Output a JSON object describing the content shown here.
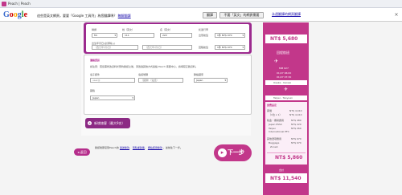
{
  "window": {
    "title": "Peach | Peach"
  },
  "google_bar": {
    "logo_letters": [
      "G",
      "o",
      "o",
      "g",
      "l",
      "e"
    ],
    "message_prefix": "這些是英文網頁，要要「Google 工具列」為您翻譯嗎？",
    "link_text": "瞭解翻譯",
    "translate_button": "翻譯",
    "never_button": "不要「英文」的網頁需要",
    "options_link": "永遠翻譯的網頁翻譯",
    "close": "×"
  },
  "form": {
    "passenger_section": {
      "title_label": "稱謂",
      "title_value": "Mr.",
      "surname_label": "姓（英文）",
      "surname_value": "111",
      "givenname_label": "名（英文）",
      "givenname_value": "222",
      "birth_label": "出生年月日(必須輸入)",
      "baggage_label": "託運行李",
      "baggage_outbound_label": "出發航班",
      "baggage_return_label": "回程航班",
      "baggage_outbound_value": "1件 NT$ 970",
      "baggage_return_value": "1件 NT$ 970",
      "dob_placeholder": "（西元年/月/日）"
    },
    "contact_section": {
      "title": "連絡資訊",
      "note": "請注意：若您需修改資料於預約確認之後，須透過其他方式連絡 Peach 客服中心，請填寫正確資料。",
      "email_label": "電子郵件",
      "phone_label": "電話號碼",
      "country_label": "聯絡國家",
      "email_placeholder": "user@",
      "phone_placeholder": "（國碼）（電話）",
      "country_value": "Japan",
      "nationality_label": "國籍",
      "nationality_value": "Japan"
    },
    "add_passenger_button": "新增旅客（最大9名）"
  },
  "footer": {
    "back_button": "返回",
    "note_prefix": "確認後即接受Peach的",
    "link1": "運送條款",
    "link2": "隱私權政策",
    "link3": "網站使用條款",
    "note_suffix": "，並前往下一步。",
    "next_button": "下一步"
  },
  "summary": {
    "outbound_price": "NT$ 5,680",
    "return_label": "回程航班",
    "flight_number": "MM 027",
    "date_depart": "01/27 06:00",
    "date_arrive": "01/27 07:30",
    "route_return": "Osaka - Kansai",
    "route_return_to": "Taipei - Taoyuan",
    "fare_type": "旅費設定",
    "fare_adult_label": "票價",
    "fare_adult_value": "NT$ 4,410",
    "fare_adult_sub": "（1位 x 1）",
    "fare_adult_total": "NT$ 4,410",
    "tax_label": "稅金・機場費用",
    "tax_value": "NT$ 480",
    "tax_item1": "Japan PSSC",
    "tax_item1_value": "NT$ 220",
    "tax_item2": "Taipei International PFC",
    "tax_item2_value": "NT$ 260",
    "options_label": "其他選項費用",
    "options_value": "NT$ 970",
    "baggage_item": "Baggage",
    "baggage_item_value": "NT$ 970",
    "zone": "Zone4",
    "return_subtotal": "NT$ 5,860",
    "total_label": "合計",
    "total_value": "NT$ 11,540"
  },
  "colors": {
    "brand": "#c2378a",
    "brand_dark": "#9c2a8e"
  }
}
